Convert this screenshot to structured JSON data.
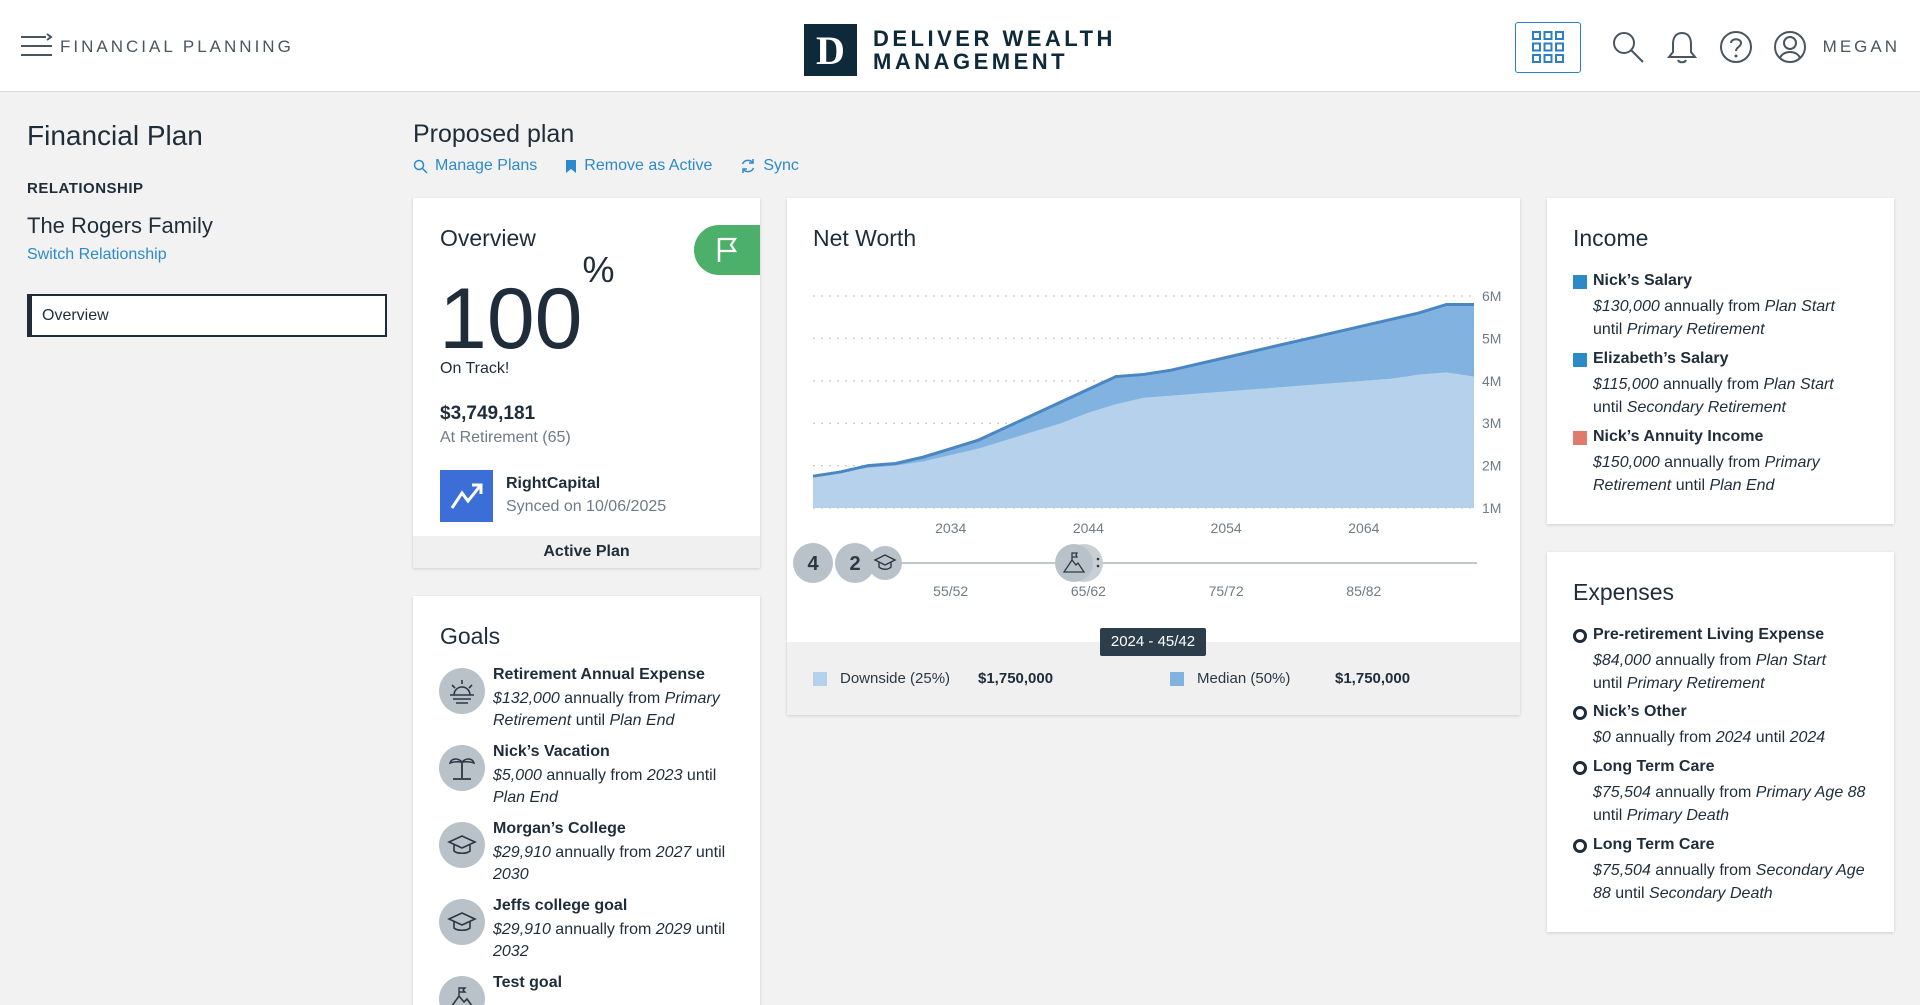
{
  "header": {
    "app_title": "FINANCIAL PLANNING",
    "logo_letter": "D",
    "logo_line1": "DELIVER WEALTH",
    "logo_line2": "MANAGEMENT",
    "user_name": "MEGAN"
  },
  "sidebar": {
    "title": "Financial Plan",
    "relationship_label": "RELATIONSHIP",
    "family_name": "The Rogers Family",
    "switch_link": "Switch Relationship",
    "nav_items": [
      {
        "label": "Overview",
        "active": true
      }
    ]
  },
  "plan": {
    "title": "Proposed plan",
    "actions": [
      {
        "label": "Manage Plans",
        "icon": "search-icon"
      },
      {
        "label": "Remove as Active",
        "icon": "bookmark-icon"
      },
      {
        "label": "Sync",
        "icon": "sync-icon"
      }
    ]
  },
  "overview": {
    "title": "Overview",
    "percent": "100",
    "percent_sign": "%",
    "status": "On Track!",
    "amount": "$3,749,181",
    "amount_caption": "At Retirement (65)",
    "provider_name": "RightCapital",
    "synced": "Synced on 10/06/2025",
    "footer": "Active Plan"
  },
  "goals": {
    "title": "Goals",
    "items": [
      {
        "name": "Retirement Annual Expense",
        "amount": "$132,000",
        "mid": " annually from ",
        "from": "Primary Retirement",
        "until_word": " until ",
        "until": "Plan End",
        "icon": "sunset-icon"
      },
      {
        "name": "Nick’s Vacation",
        "amount": "$5,000",
        "mid": " annually from ",
        "from": "2023",
        "until_word": " until ",
        "until": "Plan End",
        "icon": "palm-tree-icon"
      },
      {
        "name": "Morgan’s College",
        "amount": "$29,910",
        "mid": " annually from ",
        "from": "2027",
        "until_word": " until ",
        "until": "2030",
        "icon": "graduation-cap-icon"
      },
      {
        "name": "Jeffs college goal",
        "amount": "$29,910",
        "mid": " annually from ",
        "from": "2029",
        "until_word": " until ",
        "until": "2032",
        "icon": "graduation-cap-icon"
      },
      {
        "name": "Test goal",
        "amount": "",
        "mid": "",
        "from": "",
        "until_word": "",
        "until": "",
        "icon": "mountain-flag-icon"
      }
    ]
  },
  "net_worth": {
    "title": "Net Worth",
    "timeline_badges": [
      "4",
      "2"
    ],
    "tooltip": "2024 - 45/42",
    "legend": [
      {
        "label": "Downside (25%)",
        "value": "$1,750,000",
        "color": "#b5d1ec"
      },
      {
        "label": "Median (50%)",
        "value": "$1,750,000",
        "color": "#82b3e0"
      }
    ]
  },
  "chart_data": {
    "type": "area",
    "title": "Net Worth",
    "x_ticks": [
      "2034",
      "2044",
      "2054",
      "2064"
    ],
    "age_ticks": [
      "55/52",
      "65/62",
      "75/72",
      "85/82"
    ],
    "y_ticks": [
      "1M",
      "2M",
      "3M",
      "4M",
      "5M",
      "6M"
    ],
    "ylim": [
      1000000,
      6000000
    ],
    "xlim": [
      2024,
      2072
    ],
    "x": [
      2024,
      2026,
      2028,
      2030,
      2032,
      2034,
      2036,
      2038,
      2040,
      2042,
      2044,
      2046,
      2048,
      2050,
      2052,
      2054,
      2056,
      2058,
      2060,
      2062,
      2064,
      2066,
      2068,
      2070,
      2072
    ],
    "series": [
      {
        "name": "Downside (25%)",
        "values": [
          1750000,
          1850000,
          1950000,
          2000000,
          2100000,
          2250000,
          2400000,
          2600000,
          2800000,
          3000000,
          3250000,
          3450000,
          3600000,
          3650000,
          3700000,
          3750000,
          3800000,
          3850000,
          3900000,
          3950000,
          4000000,
          4050000,
          4150000,
          4200000,
          4100000
        ]
      },
      {
        "name": "Median (50%)",
        "values": [
          1750000,
          1850000,
          2000000,
          2050000,
          2200000,
          2400000,
          2600000,
          2900000,
          3200000,
          3500000,
          3800000,
          4100000,
          4150000,
          4250000,
          4400000,
          4550000,
          4700000,
          4850000,
          5000000,
          5150000,
          5300000,
          5450000,
          5600000,
          5800000,
          5800000
        ]
      }
    ],
    "grid": true,
    "colors": {
      "downside": "#b5d1ec",
      "median": "#82b3e0",
      "line": "#4a86c2"
    }
  },
  "income": {
    "title": "Income",
    "items": [
      {
        "name": "Nick’s Salary",
        "amount": "$130,000",
        "mid": " annually from ",
        "from": "Plan Start",
        "until_word": "until ",
        "until": "Primary Retirement",
        "color": "#2d8ac9"
      },
      {
        "name": "Elizabeth’s Salary",
        "amount": "$115,000",
        "mid": " annually from ",
        "from": "Plan Start",
        "until_word": "until ",
        "until": "Secondary Retirement",
        "color": "#2d8ac9"
      },
      {
        "name": "Nick’s Annuity Income",
        "amount": "$150,000",
        "mid": " annually from ",
        "from": "Primary Retirement",
        "until_word": " until ",
        "until": "Plan End",
        "color": "#e07a6a"
      }
    ]
  },
  "expenses": {
    "title": "Expenses",
    "items": [
      {
        "name": "Pre-retirement Living Expense",
        "amount": "$84,000",
        "mid": " annually from ",
        "from": "Plan Start",
        "until_word": "until ",
        "until": "Primary Retirement"
      },
      {
        "name": "Nick’s Other",
        "amount": "$0",
        "mid": " annually from ",
        "from": "2024",
        "until_word": " until ",
        "until": "2024"
      },
      {
        "name": "Long Term Care",
        "amount": "$75,504",
        "mid": " annually from ",
        "from": "Primary Age 88",
        "until_word": " until ",
        "until": "Primary Death"
      },
      {
        "name": "Long Term Care",
        "amount": "$75,504",
        "mid": " annually from ",
        "from": "Secondary Age 88",
        "until_word": " until ",
        "until": "Secondary Death"
      }
    ]
  }
}
